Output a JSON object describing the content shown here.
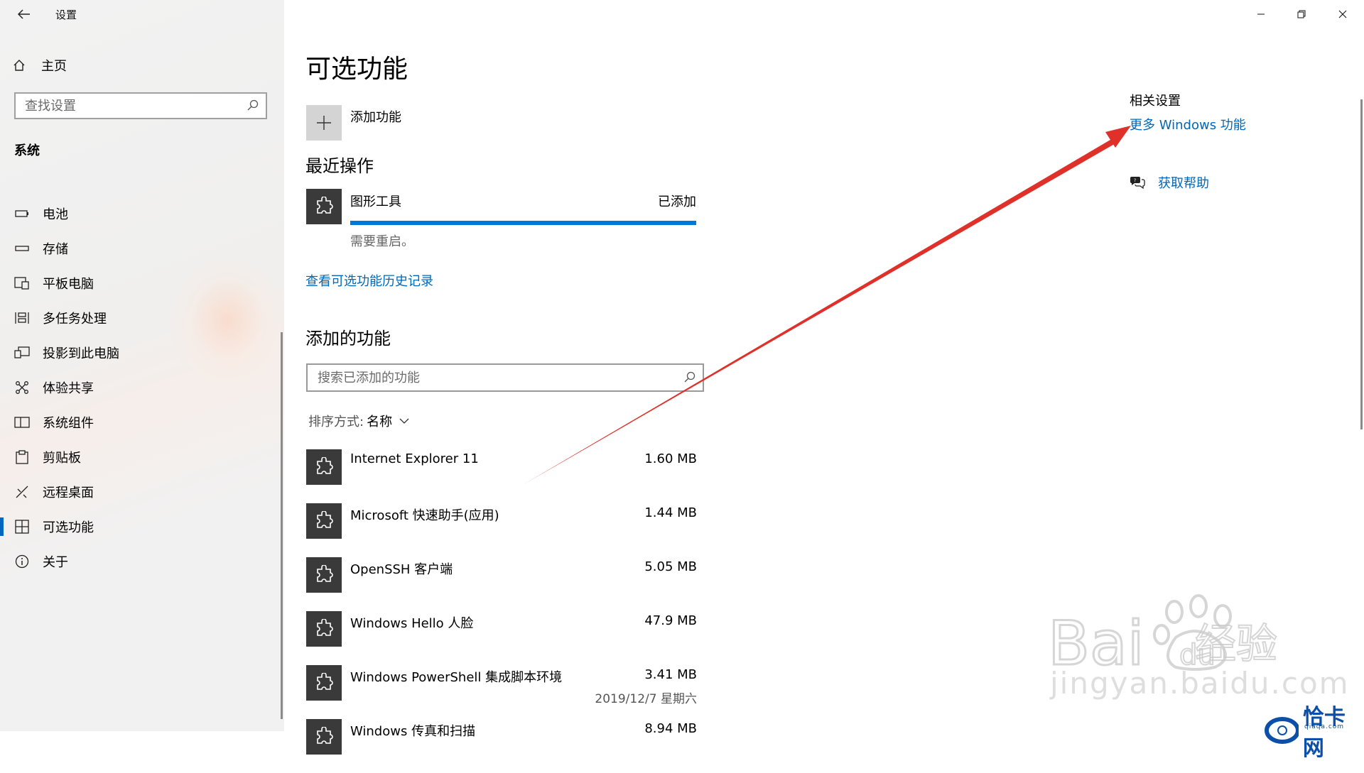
{
  "app": {
    "title": "设置",
    "back_icon": "back-arrow-icon"
  },
  "sidebar": {
    "home_label": "主页",
    "search_placeholder": "查找设置",
    "section": "系统",
    "items": [
      {
        "label": "电池",
        "icon": "battery-icon",
        "selected": false
      },
      {
        "label": "存储",
        "icon": "storage-icon",
        "selected": false
      },
      {
        "label": "平板电脑",
        "icon": "tablet-icon",
        "selected": false
      },
      {
        "label": "多任务处理",
        "icon": "multitasking-icon",
        "selected": false
      },
      {
        "label": "投影到此电脑",
        "icon": "project-icon",
        "selected": false
      },
      {
        "label": "体验共享",
        "icon": "share-icon",
        "selected": false
      },
      {
        "label": "系统组件",
        "icon": "components-icon",
        "selected": false
      },
      {
        "label": "剪贴板",
        "icon": "clipboard-icon",
        "selected": false
      },
      {
        "label": "远程桌面",
        "icon": "remote-desktop-icon",
        "selected": false
      },
      {
        "label": "可选功能",
        "icon": "optional-features-icon",
        "selected": true
      },
      {
        "label": "关于",
        "icon": "info-icon",
        "selected": false
      }
    ],
    "accent": "#0067c0"
  },
  "main": {
    "title": "可选功能",
    "add_feature_label": "添加功能",
    "recent_heading": "最近操作",
    "recent": {
      "name": "图形工具",
      "status": "已添加",
      "progress": 1.0,
      "note": "需要重启。"
    },
    "history_link": "查看可选功能历史记录",
    "installed_heading": "添加的功能",
    "installed_search_placeholder": "搜索已添加的功能",
    "sort_label": "排序方式:",
    "sort_value": "名称",
    "features": [
      {
        "name": "Internet Explorer 11",
        "size": "1.60 MB"
      },
      {
        "name": "Microsoft 快速助手(应用)",
        "size": "1.44 MB"
      },
      {
        "name": "OpenSSH 客户端",
        "size": "5.05 MB"
      },
      {
        "name": "Windows Hello 人脸",
        "size": "47.9 MB"
      },
      {
        "name": "Windows PowerShell 集成脚本环境",
        "size": "3.41 MB",
        "date": "2019/12/7 星期六"
      },
      {
        "name": "Windows 传真和扫描",
        "size": "8.94 MB"
      }
    ]
  },
  "related": {
    "title": "相关设置",
    "more_link": "更多 Windows 功能",
    "help_label": "获取帮助"
  },
  "colors": {
    "link": "#0067b8",
    "progress": "#0078d7",
    "annotation_arrow": "#e0302a"
  },
  "watermark": {
    "brand": "Baidu经验",
    "url": "jingyan.baidu.com",
    "badge": "恰卡网",
    "badge_sub": "qiaqa.com"
  }
}
